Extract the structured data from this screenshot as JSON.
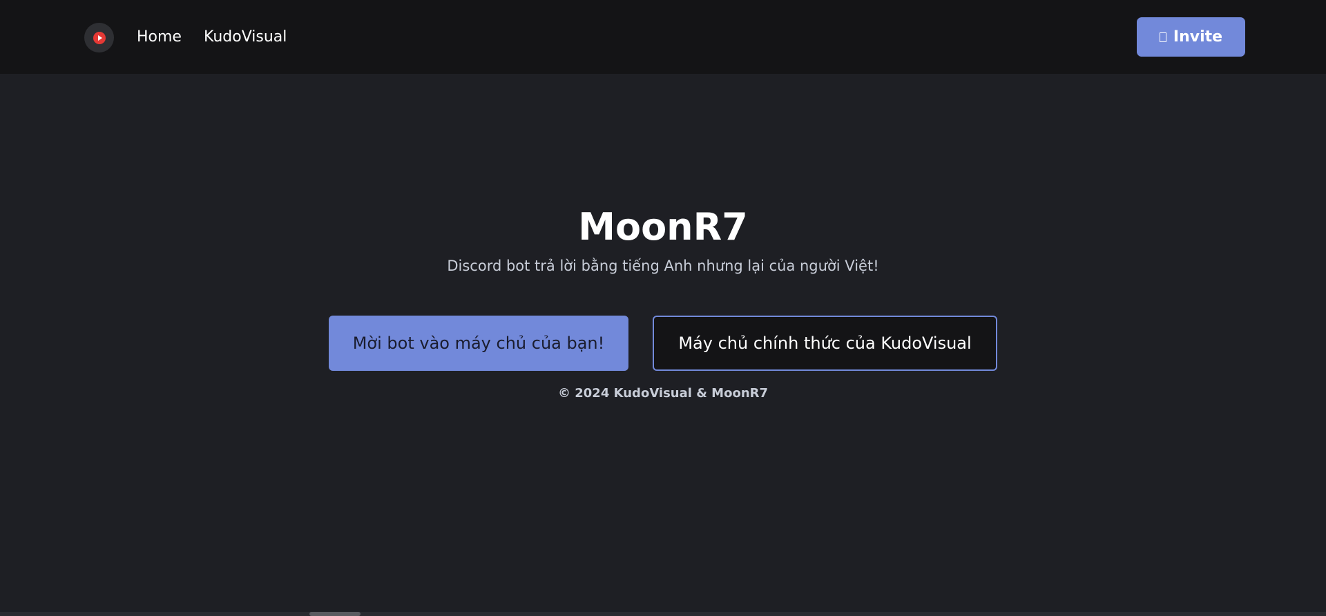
{
  "nav": {
    "logo_icon": "play-circle-icon",
    "links": [
      "Home",
      "KudoVisual"
    ],
    "invite_label": "Invite",
    "invite_icon": "square-icon"
  },
  "hero": {
    "title": "MoonR7",
    "subtitle": "Discord bot trả lời bằng tiếng Anh nhưng lại của người Việt!",
    "primary_button": "Mời bot vào máy chủ của bạn!",
    "secondary_button": "Máy chủ chính thức của KudoVisual"
  },
  "footer": {
    "text": "© 2024 KudoVisual & MoonR7"
  },
  "colors": {
    "accent": "#7289da",
    "background": "#1e1f24",
    "navbar": "#141416",
    "logo_red": "#e53935"
  }
}
